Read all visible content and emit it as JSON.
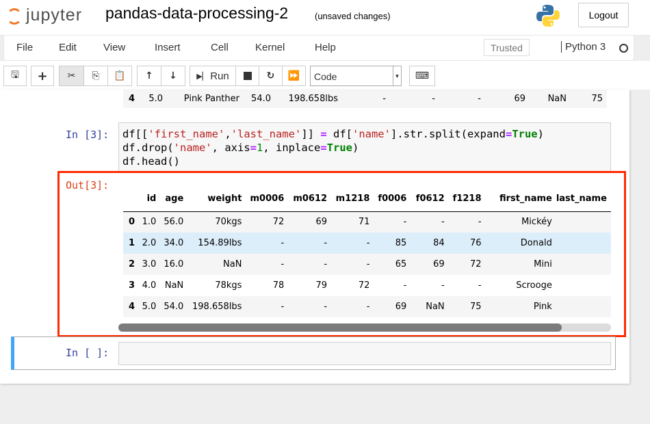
{
  "header": {
    "logo_text": "jupyter",
    "notebook_title": "pandas-data-processing-2",
    "save_status": "(unsaved changes)",
    "logout_label": "Logout"
  },
  "menubar": {
    "items": [
      "File",
      "Edit",
      "View",
      "Insert",
      "Cell",
      "Kernel",
      "Help"
    ],
    "trusted_label": "Trusted",
    "kernel_name": "Python 3"
  },
  "toolbar": {
    "run_label": "Run",
    "cell_type": "Code"
  },
  "previous_output_row": [
    "4",
    "5.0",
    "Pink Panther",
    "54.0",
    "198.658lbs",
    "-",
    "-",
    "-",
    "69",
    "NaN",
    "75"
  ],
  "cell3": {
    "in_prompt": "In [3]:",
    "out_prompt": "Out[3]:",
    "dataframe": {
      "columns": [
        "",
        "id",
        "age",
        "weight",
        "m0006",
        "m0612",
        "m1218",
        "f0006",
        "f0612",
        "f1218",
        "first_name",
        "last_name"
      ],
      "rows": [
        [
          "0",
          "1.0",
          "56.0",
          "70kgs",
          "72",
          "69",
          "71",
          "-",
          "-",
          "-",
          "Mickéy",
          ""
        ],
        [
          "1",
          "2.0",
          "34.0",
          "154.89lbs",
          "-",
          "-",
          "-",
          "85",
          "84",
          "76",
          "Donald",
          ""
        ],
        [
          "2",
          "3.0",
          "16.0",
          "NaN",
          "-",
          "-",
          "-",
          "65",
          "69",
          "72",
          "Mini",
          ""
        ],
        [
          "3",
          "4.0",
          "NaN",
          "78kgs",
          "78",
          "79",
          "72",
          "-",
          "-",
          "-",
          "Scrooge",
          ""
        ],
        [
          "4",
          "5.0",
          "54.0",
          "198.658lbs",
          "-",
          "-",
          "-",
          "69",
          "NaN",
          "75",
          "Pink",
          ""
        ]
      ],
      "horizontal_scroll_fraction": 0.9
    }
  },
  "new_cell": {
    "in_prompt": "In [ ]:"
  },
  "colors": {
    "highlight_border": "#ff2a00",
    "selected_cell_bar": "#42a5f5",
    "in_prompt": "#303f9f",
    "out_prompt": "#d84315"
  }
}
